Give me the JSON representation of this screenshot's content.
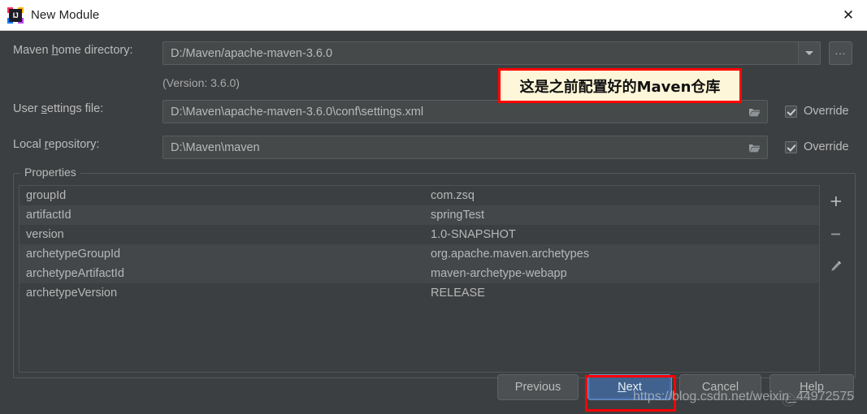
{
  "window": {
    "title": "New Module",
    "app_icon": "intellij-idea-icon",
    "close_icon": "close-icon"
  },
  "form": {
    "maven_home": {
      "label_before": "Maven ",
      "label_mnemonic": "h",
      "label_after": "ome directory:",
      "value": "D:/Maven/apache-maven-3.6.0",
      "dropdown_icon": "chevron-down-icon",
      "browse_label": "..."
    },
    "version_note": "(Version: 3.6.0)",
    "user_settings": {
      "label_before": "User ",
      "label_mnemonic": "s",
      "label_after": "ettings file:",
      "value": "D:\\Maven\\apache-maven-3.6.0\\conf\\settings.xml",
      "folder_icon": "folder-icon",
      "override_label": "Override",
      "override_checked": true
    },
    "local_repository": {
      "label_before": "Local ",
      "label_mnemonic": "r",
      "label_after": "epository:",
      "value": "D:\\Maven\\maven",
      "folder_icon": "folder-icon",
      "override_label": "Override",
      "override_checked": true
    }
  },
  "properties": {
    "legend": "Properties",
    "rows": [
      {
        "name": "groupId",
        "value": "com.zsq"
      },
      {
        "name": "artifactId",
        "value": "springTest"
      },
      {
        "name": "version",
        "value": "1.0-SNAPSHOT"
      },
      {
        "name": "archetypeGroupId",
        "value": "org.apache.maven.archetypes"
      },
      {
        "name": "archetypeArtifactId",
        "value": "maven-archetype-webapp"
      },
      {
        "name": "archetypeVersion",
        "value": "RELEASE"
      }
    ],
    "toolbar": {
      "add_icon": "plus-icon",
      "remove_icon": "minus-icon",
      "edit_icon": "pencil-icon"
    }
  },
  "buttons": {
    "previous": "Previous",
    "next_before": "",
    "next_mnemonic": "N",
    "next_after": "ext",
    "cancel": "Cancel",
    "help_before": "",
    "help_mnemonic": "H",
    "help_after": "elp"
  },
  "annotations": {
    "callout_text": "这是之前配置好的Maven仓库",
    "callout_border_color": "#ff0000",
    "callout_background": "#fdf6d8",
    "next_highlight_color": "#ff0000",
    "watermark": "https://blog.csdn.net/weixin_44972575"
  }
}
